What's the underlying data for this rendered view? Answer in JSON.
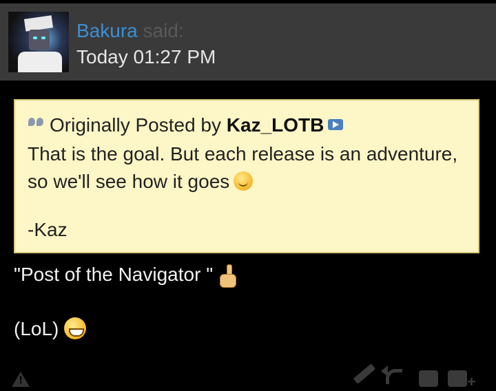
{
  "post": {
    "author": "Bakura",
    "said": "said:",
    "date": "Today 01:27 PM"
  },
  "quote": {
    "prefix": "Originally Posted by",
    "author": "Kaz_LOTB",
    "text": "That is the goal. But each release is an adventure, so we'll see how it goes",
    "signature": "-Kaz"
  },
  "message": {
    "line1": "\"Post of the Navigator \"",
    "line2": "(LoL)"
  },
  "icons": {
    "avatar": "user-avatar",
    "quote_marks": "quote-marks-icon",
    "view_post": "view-post-icon",
    "smile": "smile-emoji",
    "finger": "pointing-up-emoji",
    "grin": "grin-emoji",
    "report": "report-icon",
    "edit": "edit-icon",
    "reply": "reply-icon",
    "quote_reply": "quote-reply-icon",
    "multiquote": "multiquote-icon"
  },
  "colors": {
    "header_bg": "#3a3a3a",
    "author_link": "#3a8fd6",
    "quote_bg": "#fdf6c6",
    "quote_border": "#d9c77a",
    "body_bg": "#000000"
  }
}
